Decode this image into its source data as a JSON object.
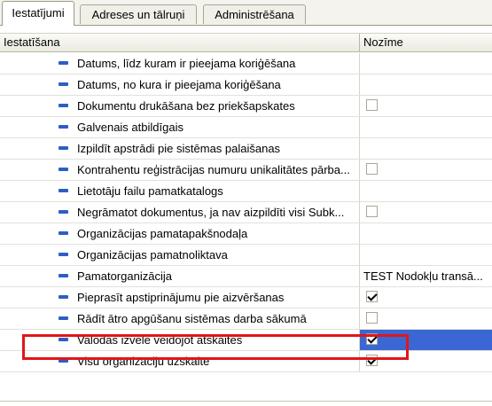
{
  "tabs": [
    {
      "label": "Iestatījumi",
      "active": true
    },
    {
      "label": "Adreses un tālruņi",
      "active": false
    },
    {
      "label": "Administrēšana",
      "active": false
    }
  ],
  "grid": {
    "columns": [
      "Iestatīšana",
      "Nozīme"
    ],
    "rows": [
      {
        "label": "Datums, līdz kuram ir pieejama koriģēšana",
        "value_type": "text",
        "value": ""
      },
      {
        "label": "Datums, no kura ir pieejama koriģēšana",
        "value_type": "text",
        "value": ""
      },
      {
        "label": "Dokumentu drukāšana bez priekšapskates",
        "value_type": "checkbox",
        "checked": false
      },
      {
        "label": "Galvenais atbildīgais",
        "value_type": "text",
        "value": ""
      },
      {
        "label": "Izpildīt apstrādi pie sistēmas palaišanas",
        "value_type": "text",
        "value": ""
      },
      {
        "label": "Kontrahentu reģistrācijas numuru unikalitātes pārbа...",
        "value_type": "checkbox",
        "checked": false
      },
      {
        "label": "Lietotāju failu pamatkatalogs",
        "value_type": "text",
        "value": ""
      },
      {
        "label": "Negrāmatot dokumentus, ja nav aizpildīti visi Subk...",
        "value_type": "checkbox",
        "checked": false
      },
      {
        "label": "Organizācijas pamatapakšnodaļa",
        "value_type": "text",
        "value": ""
      },
      {
        "label": "Organizācijas pamatnoliktava",
        "value_type": "text",
        "value": ""
      },
      {
        "label": "Pamatorganizācija",
        "value_type": "text",
        "value": "TEST Nodokļu transā..."
      },
      {
        "label": "Pieprasīt apstiprinājumu pie aizvēršanas",
        "value_type": "checkbox",
        "checked": true
      },
      {
        "label": "Rādīt ātro apgūšanu sistēmas darba sākumā",
        "value_type": "checkbox",
        "checked": false
      },
      {
        "label": "Valodas izvēle veidojot atskaites",
        "value_type": "checkbox",
        "checked": true,
        "selected": true
      },
      {
        "label": "Visu organizāciju uzskaite",
        "value_type": "checkbox",
        "checked": true
      }
    ]
  },
  "colors": {
    "selection": "#3b67d4",
    "highlight_border": "#e0161b",
    "row_icon": "#2d5fc2"
  }
}
